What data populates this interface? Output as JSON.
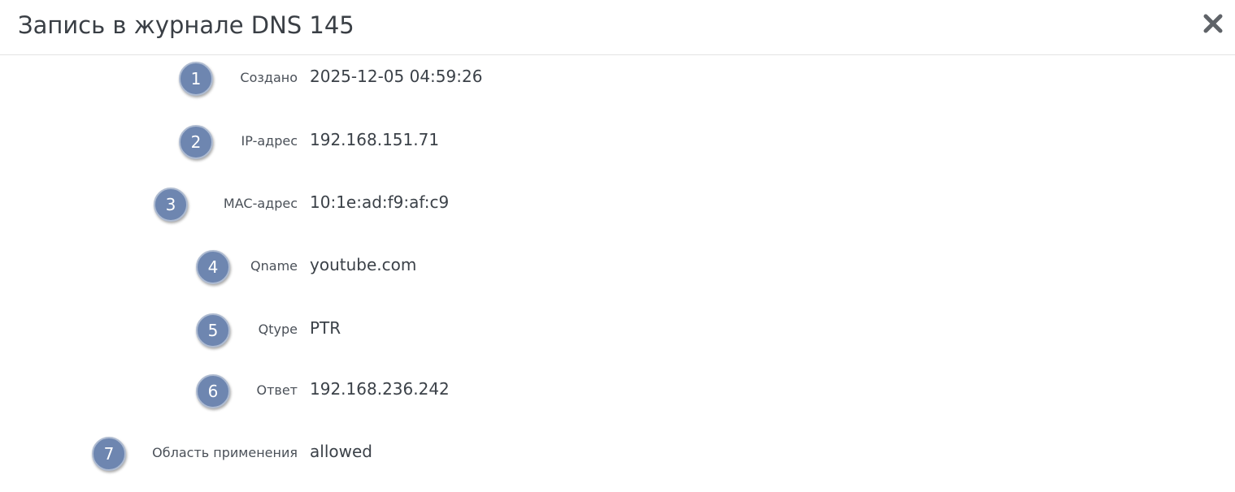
{
  "dialog": {
    "title": "Запись в журнале DNS 145",
    "close_icon": "close-icon"
  },
  "accent_colors": {
    "badge": "#6e86b0",
    "badge_border": "#aebbd1"
  },
  "fields": [
    {
      "number": "1",
      "label": "Создано",
      "value": "2025-12-05 04:59:26"
    },
    {
      "number": "2",
      "label": "IP-адрес",
      "value": "192.168.151.71"
    },
    {
      "number": "3",
      "label": "MAC-адрес",
      "value": "10:1e:ad:f9:af:c9"
    },
    {
      "number": "4",
      "label": "Qname",
      "value": "youtube.com"
    },
    {
      "number": "5",
      "label": "Qtype",
      "value": "PTR"
    },
    {
      "number": "6",
      "label": "Ответ",
      "value": "192.168.236.242"
    },
    {
      "number": "7",
      "label": "Область применения",
      "value": "allowed"
    }
  ]
}
